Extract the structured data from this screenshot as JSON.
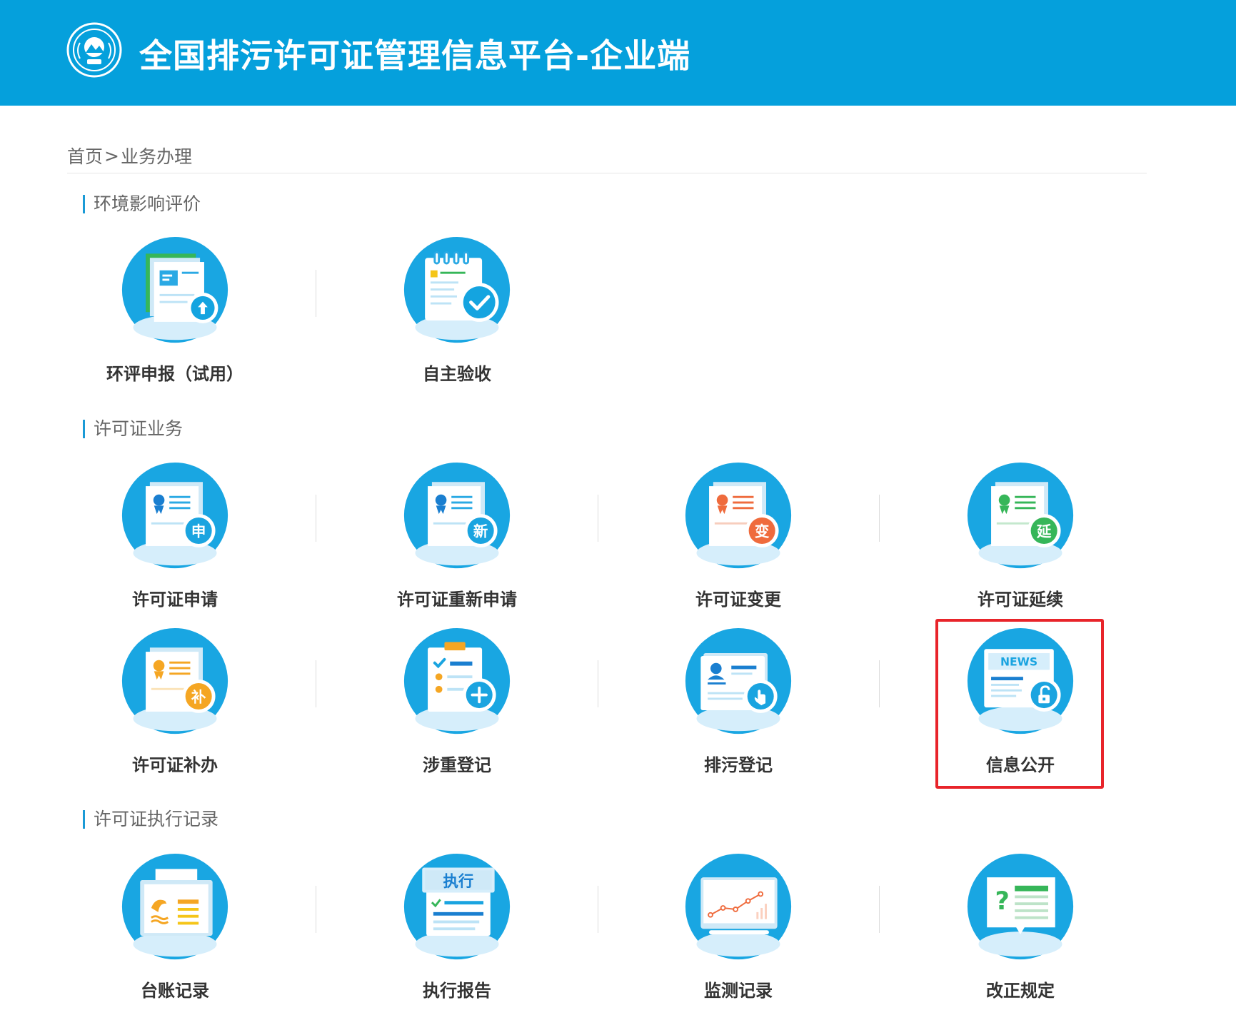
{
  "header": {
    "title": "全国排污许可证管理信息平台-企业端",
    "logo_icon": "mee-emblem-icon",
    "brand_color": "#05a0dc"
  },
  "breadcrumb": {
    "home": "首页",
    "separator": ">",
    "current": "业务办理"
  },
  "sections": {
    "eia": {
      "title": "环境影响评价",
      "items": [
        {
          "label": "环评申报（试用）",
          "icon": "document-upload-icon"
        },
        {
          "label": "自主验收",
          "icon": "checklist-check-icon"
        }
      ]
    },
    "permit": {
      "title": "许可证业务",
      "items": [
        {
          "label": "许可证申请",
          "icon": "permit-apply-icon",
          "badge": "申"
        },
        {
          "label": "许可证重新申请",
          "icon": "permit-reapply-icon",
          "badge": "新"
        },
        {
          "label": "许可证变更",
          "icon": "permit-change-icon",
          "badge": "变"
        },
        {
          "label": "许可证延续",
          "icon": "permit-extend-icon",
          "badge": "延"
        },
        {
          "label": "许可证补办",
          "icon": "permit-reissue-icon",
          "badge": "补"
        },
        {
          "label": "涉重登记",
          "icon": "heavy-metal-register-icon"
        },
        {
          "label": "排污登记",
          "icon": "discharge-register-icon"
        },
        {
          "label": "信息公开",
          "icon": "news-disclosure-icon",
          "news_text": "NEWS"
        }
      ]
    },
    "records": {
      "title": "许可证执行记录",
      "items": [
        {
          "label": "台账记录",
          "icon": "ledger-record-icon"
        },
        {
          "label": "执行报告",
          "icon": "execution-report-icon",
          "banner_text": "执行"
        },
        {
          "label": "监测记录",
          "icon": "monitoring-chart-icon"
        },
        {
          "label": "改正规定",
          "icon": "correction-rule-icon",
          "mark_text": "?"
        }
      ]
    }
  },
  "colors": {
    "icon_circle": "#19a6e2",
    "badge_blue": "#1aa4e0",
    "badge_orange": "#ef6b3d",
    "badge_green": "#36b659",
    "badge_yellow": "#f5a623",
    "highlight": "#e8242a"
  }
}
